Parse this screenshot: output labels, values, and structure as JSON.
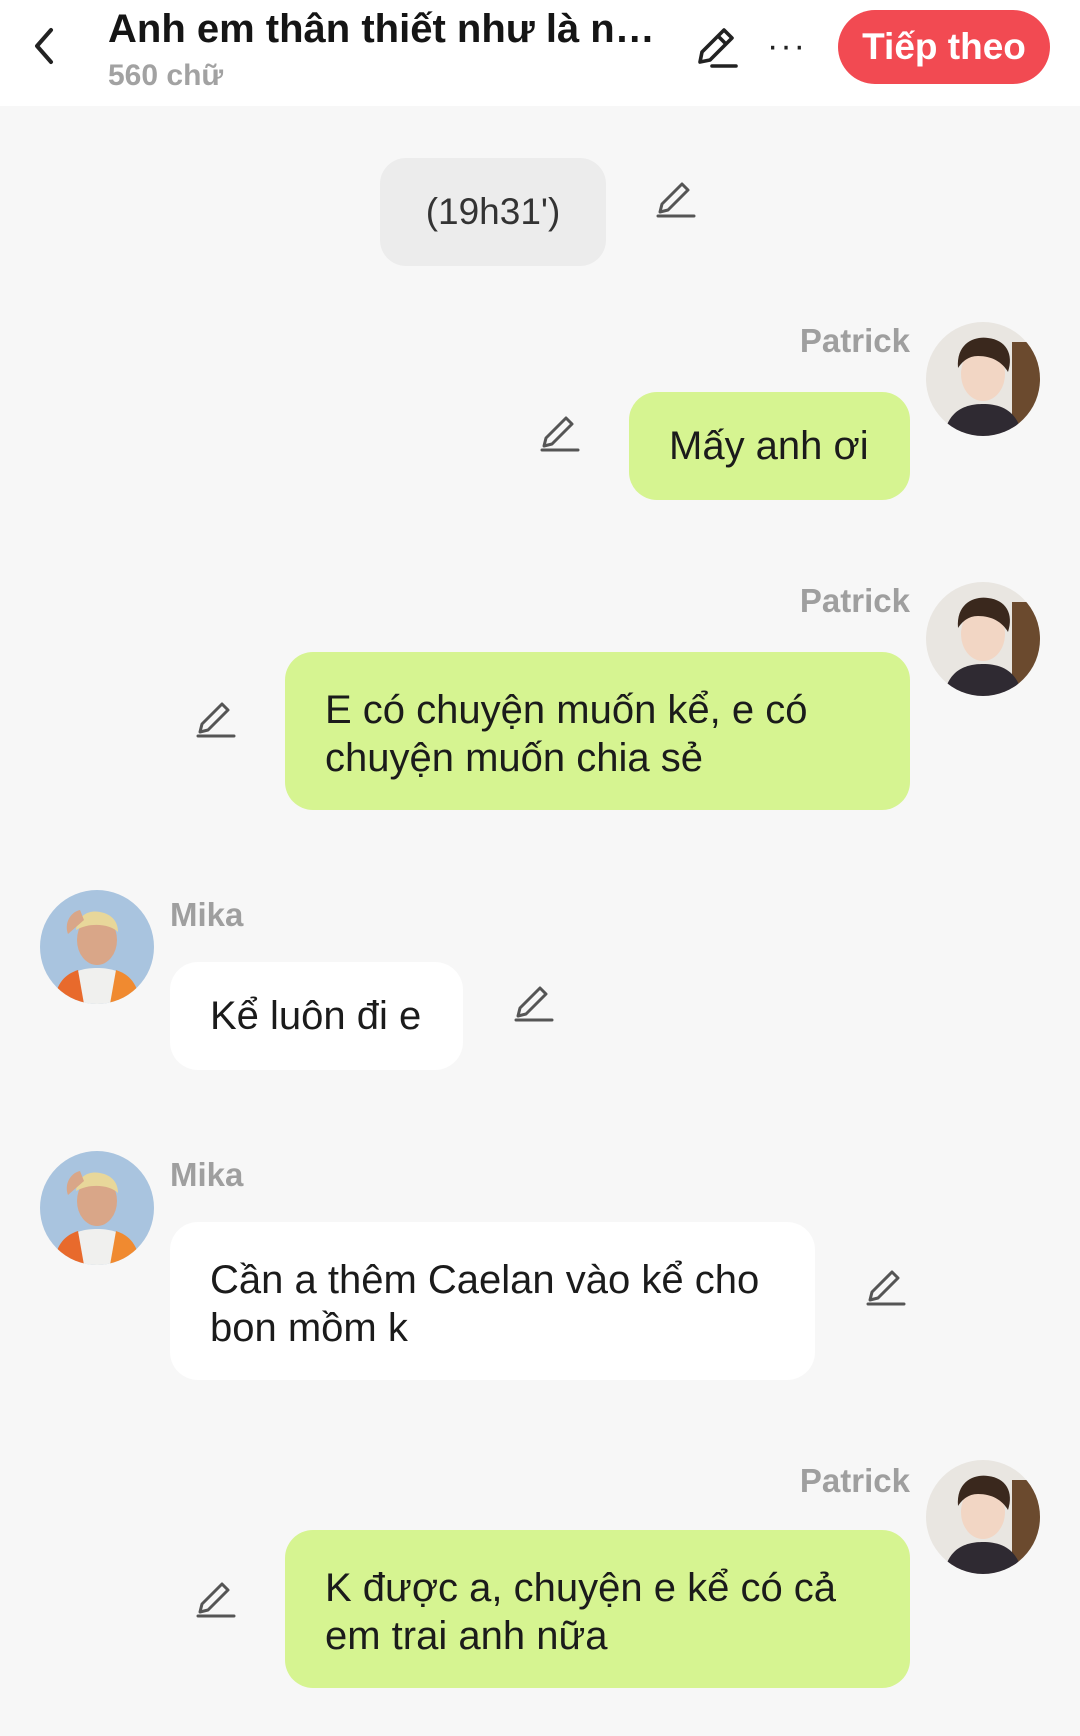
{
  "header": {
    "title": "Anh em thân thiết như là ng...",
    "subtitle": "560 chữ",
    "next_label": "Tiếp theo",
    "more_label": "···"
  },
  "time_marker": "(19h31')",
  "messages": [
    {
      "sender": "Patrick",
      "text": "Mấy anh ơi"
    },
    {
      "sender": "Patrick",
      "text": "E có chuyện muốn kể, e có chuyện muốn chia sẻ"
    },
    {
      "sender": "Mika",
      "text": "Kể luôn đi e"
    },
    {
      "sender": "Mika",
      "text": "Cần a thêm Caelan vào kể cho bon mồm k"
    },
    {
      "sender": "Patrick",
      "text": "K được a, chuyện e kể có cả em trai anh nữa"
    }
  ],
  "colors": {
    "accent": "#f24a52",
    "my_bubble": "#d6f491",
    "other_bubble": "#ffffff",
    "background": "#f7f7f7"
  },
  "icons": {
    "back": "chevron-left-icon",
    "edit": "pencil-icon",
    "more": "more-horizontal-icon"
  }
}
